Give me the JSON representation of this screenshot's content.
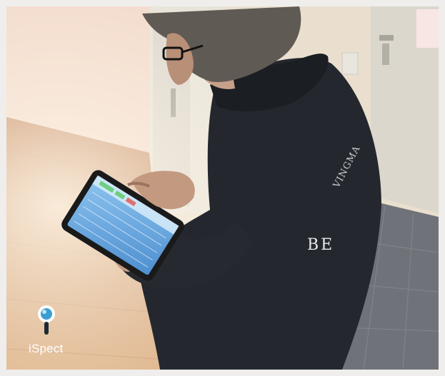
{
  "brand": {
    "name": "iSpect",
    "icon": "magnifier-pin-icon"
  },
  "jacket": {
    "chest_text": "BE",
    "sleeve_text": "VINGMA"
  },
  "colors": {
    "wall": "#e9dccb",
    "floor_wood": "#c98f5c",
    "floor_tile": "#6d7178",
    "jacket": "#23272c",
    "tablet_screen": "#6aa9e0",
    "accent": "#4aa0c8"
  }
}
